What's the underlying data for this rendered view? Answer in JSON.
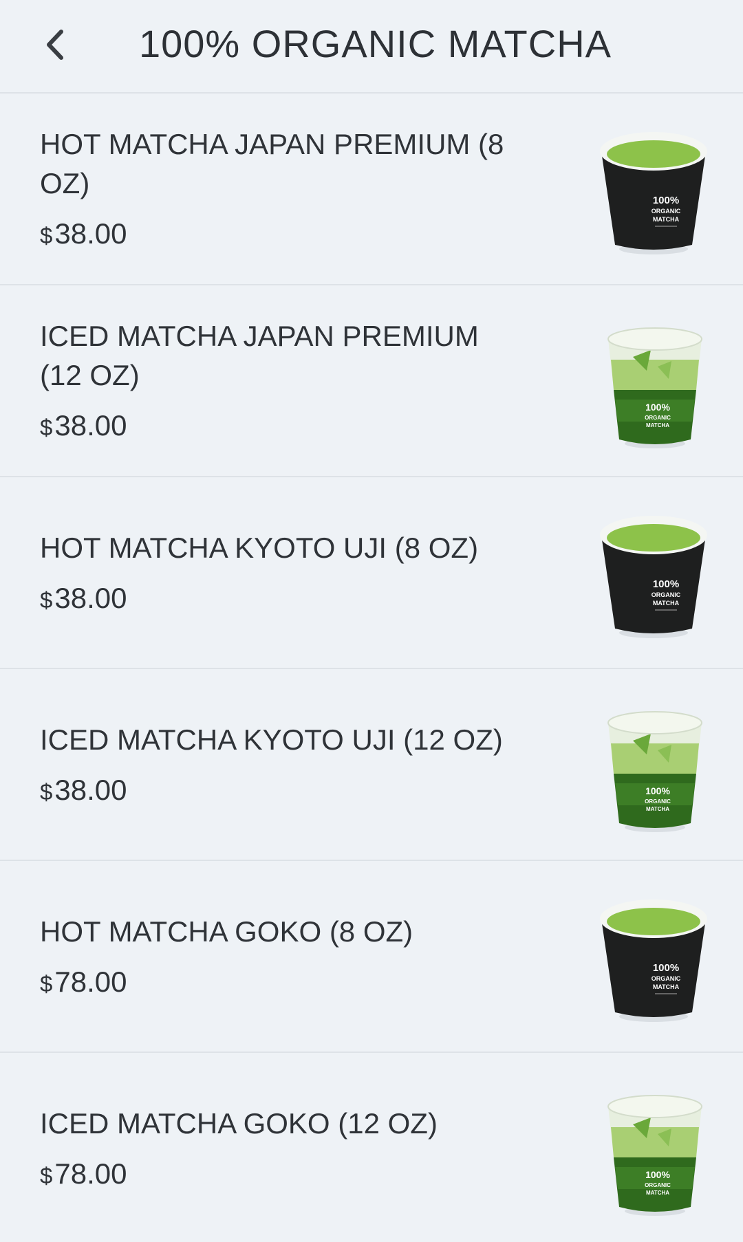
{
  "header": {
    "title": "100% ORGANIC MATCHA",
    "back_icon": "chevron-left-icon"
  },
  "colors": {
    "background": "#eef2f6",
    "divider": "#dde2e7",
    "text": "#2f3338",
    "matcha": "#8dc24a",
    "cup_dark": "#1e1f1f"
  },
  "cup_label": {
    "line1": "100%",
    "line2": "ORGANIC",
    "line3": "MATCHA"
  },
  "items": [
    {
      "name": "HOT MATCHA JAPAN PREMIUM (8 OZ)",
      "currency": "$",
      "price": "38.00",
      "image": "hot-matcha-cup"
    },
    {
      "name": "ICED MATCHA JAPAN PREMIUM (12 OZ)",
      "currency": "$",
      "price": "38.00",
      "image": "iced-matcha-cup"
    },
    {
      "name": "HOT MATCHA KYOTO UJI (8 OZ)",
      "currency": "$",
      "price": "38.00",
      "image": "hot-matcha-cup"
    },
    {
      "name": "ICED MATCHA KYOTO UJI (12 OZ)",
      "currency": "$",
      "price": "38.00",
      "image": "iced-matcha-cup"
    },
    {
      "name": "HOT MATCHA GOKO (8 OZ)",
      "currency": "$",
      "price": "78.00",
      "image": "hot-matcha-cup"
    },
    {
      "name": "ICED MATCHA GOKO (12 OZ)",
      "currency": "$",
      "price": "78.00",
      "image": "iced-matcha-cup"
    }
  ]
}
